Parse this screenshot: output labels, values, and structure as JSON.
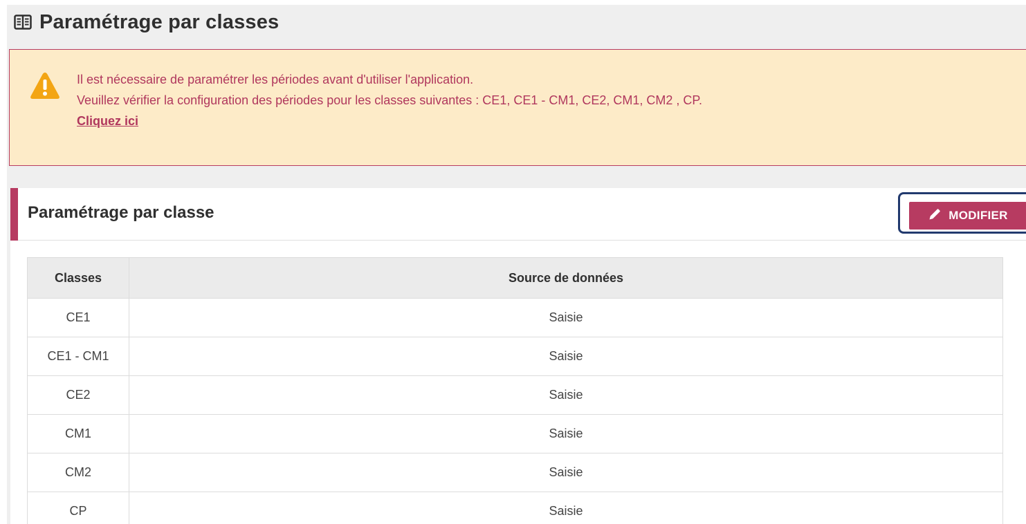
{
  "page": {
    "title": "Paramétrage par classes",
    "icon": "book-icon"
  },
  "alert": {
    "icon": "warning-icon",
    "line1": "Il est nécessaire de paramétrer les périodes avant d'utiliser l'application.",
    "line2": "Veuillez vérifier la configuration des périodes pour les classes suivantes : CE1, CE1 - CM1, CE2, CM1, CM2 , CP.",
    "link_label": "Cliquez ici",
    "background_color": "#fdebc8",
    "text_color": "#b0375d"
  },
  "section": {
    "title": "Paramétrage par classe",
    "modify_button": {
      "label": "MODIFIER",
      "icon": "pencil-icon",
      "color": "#b73b61"
    }
  },
  "table": {
    "headers": [
      "Classes",
      "Source de données"
    ],
    "rows": [
      {
        "classe": "CE1",
        "source": "Saisie"
      },
      {
        "classe": "CE1 - CM1",
        "source": "Saisie"
      },
      {
        "classe": "CE2",
        "source": "Saisie"
      },
      {
        "classe": "CM1",
        "source": "Saisie"
      },
      {
        "classe": "CM2",
        "source": "Saisie"
      },
      {
        "classe": "CP",
        "source": "Saisie"
      }
    ]
  }
}
